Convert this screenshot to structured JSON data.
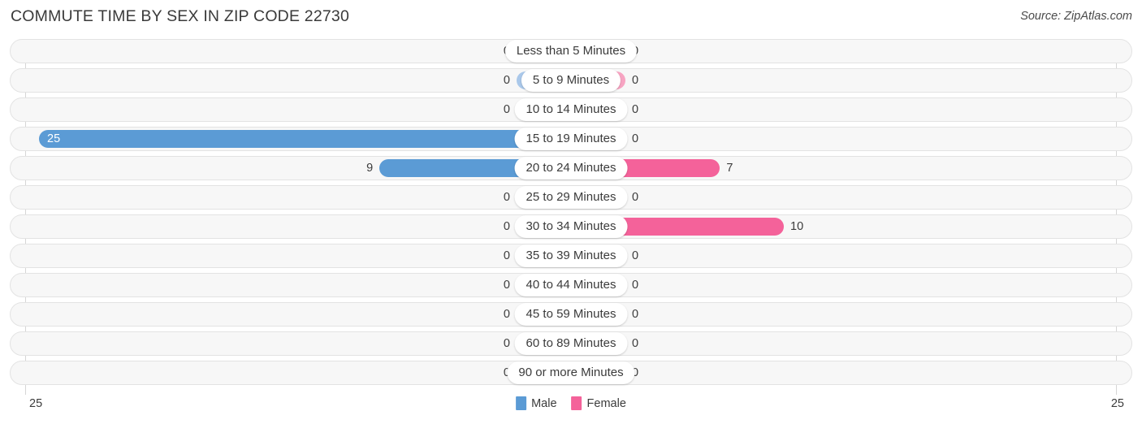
{
  "header": {
    "title": "COMMUTE TIME BY SEX IN ZIP CODE 22730",
    "source": "Source: ZipAtlas.com"
  },
  "legend": {
    "male_label": "Male",
    "female_label": "Female",
    "male_color": "#5b9bd5",
    "female_color": "#f4629a"
  },
  "axis": {
    "left_tick": "25",
    "right_tick": "25",
    "max": 25
  },
  "chart_data": {
    "type": "bar",
    "orientation": "horizontal-diverging",
    "title": "COMMUTE TIME BY SEX IN ZIP CODE 22730",
    "xlabel": "",
    "ylabel": "",
    "xlim": [
      25,
      25
    ],
    "grid": false,
    "legend_position": "bottom-center",
    "categories": [
      "Less than 5 Minutes",
      "5 to 9 Minutes",
      "10 to 14 Minutes",
      "15 to 19 Minutes",
      "20 to 24 Minutes",
      "25 to 29 Minutes",
      "30 to 34 Minutes",
      "35 to 39 Minutes",
      "40 to 44 Minutes",
      "45 to 59 Minutes",
      "60 to 89 Minutes",
      "90 or more Minutes"
    ],
    "series": [
      {
        "name": "Male",
        "values": [
          0,
          0,
          0,
          25,
          9,
          0,
          0,
          0,
          0,
          0,
          0,
          0
        ]
      },
      {
        "name": "Female",
        "values": [
          0,
          0,
          0,
          0,
          7,
          0,
          10,
          0,
          0,
          0,
          0,
          0
        ]
      }
    ]
  },
  "rows": [
    {
      "label": "Less than 5 Minutes",
      "male": "0",
      "female": "0"
    },
    {
      "label": "5 to 9 Minutes",
      "male": "0",
      "female": "0"
    },
    {
      "label": "10 to 14 Minutes",
      "male": "0",
      "female": "0"
    },
    {
      "label": "15 to 19 Minutes",
      "male": "25",
      "female": "0"
    },
    {
      "label": "20 to 24 Minutes",
      "male": "9",
      "female": "7"
    },
    {
      "label": "25 to 29 Minutes",
      "male": "0",
      "female": "0"
    },
    {
      "label": "30 to 34 Minutes",
      "male": "0",
      "female": "10"
    },
    {
      "label": "35 to 39 Minutes",
      "male": "0",
      "female": "0"
    },
    {
      "label": "40 to 44 Minutes",
      "male": "0",
      "female": "0"
    },
    {
      "label": "45 to 59 Minutes",
      "male": "0",
      "female": "0"
    },
    {
      "label": "60 to 89 Minutes",
      "male": "0",
      "female": "0"
    },
    {
      "label": "90 or more Minutes",
      "male": "0",
      "female": "0"
    }
  ]
}
